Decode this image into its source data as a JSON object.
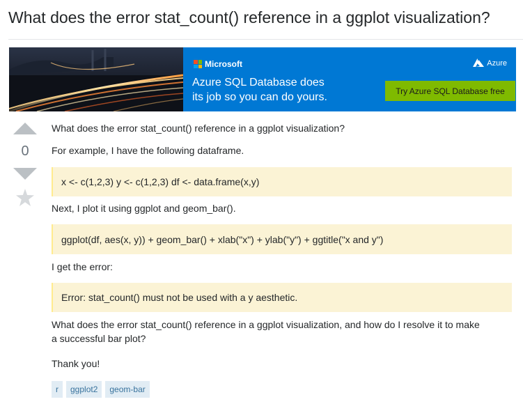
{
  "question": {
    "title": "What does the error stat_count() reference in a ggplot visualization?"
  },
  "ad": {
    "brand": "Microsoft",
    "product": "Azure",
    "tagline_line1": "Azure SQL Database does",
    "tagline_line2": "its job so you can do yours.",
    "cta": "Try Azure SQL Database free",
    "colors": {
      "background": "#0078d4",
      "cta": "#7fba00",
      "photo": "#10141c"
    }
  },
  "vote": {
    "count": "0"
  },
  "post": {
    "p1": "What does the error stat_count() reference in a ggplot visualization?",
    "p2": "For example, I have the following dataframe.",
    "code1": "x <- c(1,2,3) y <- c(1,2,3) df <- data.frame(x,y)",
    "p3": "Next, I plot it using ggplot and geom_bar().",
    "code2": "ggplot(df, aes(x, y)) + geom_bar() + xlab(\"x\") + ylab(\"y\") + ggtitle(\"x and y\")",
    "p4": "I get the error:",
    "code3": "Error: stat_count() must not be used with a y aesthetic.",
    "p5_line1": "What does the error stat_count() reference in a ggplot visualization, and how do I resolve it to make",
    "p5_line2": "a successful bar plot?",
    "p6": "Thank you!"
  },
  "tags": [
    "r",
    "ggplot2",
    "geom-bar"
  ],
  "colors": {
    "code_bg": "#fbf3d5",
    "tag_bg": "#e1ecf4",
    "tag_text": "#39739d",
    "vote_arrow": "#bbc0c4"
  }
}
